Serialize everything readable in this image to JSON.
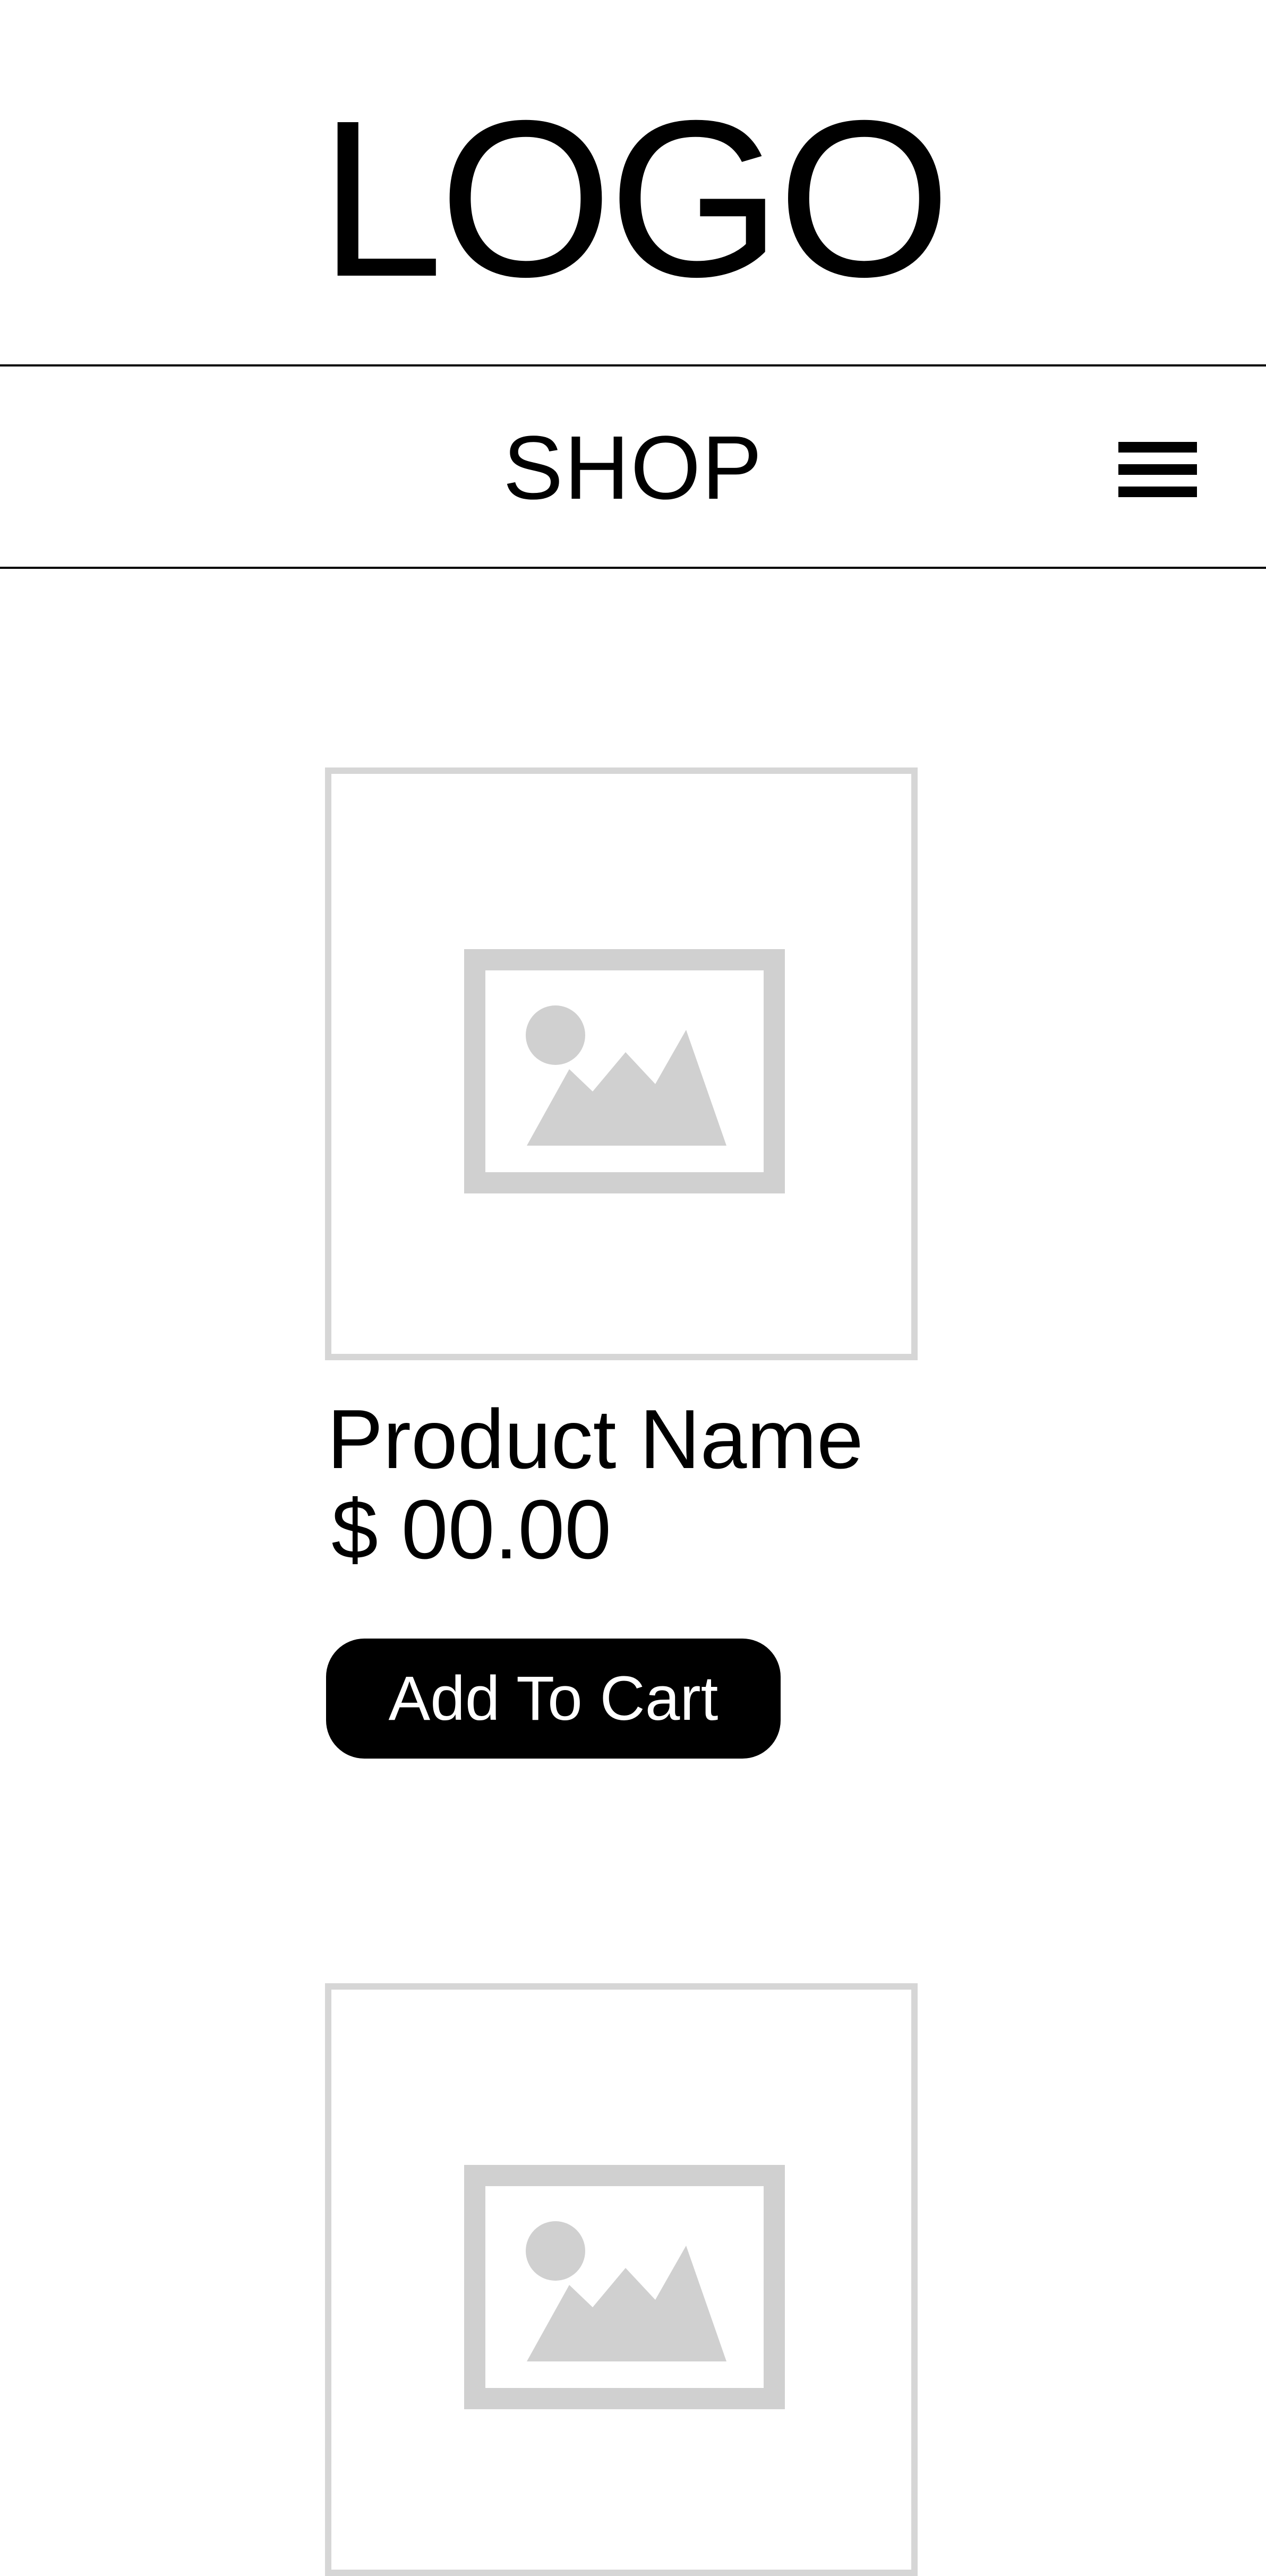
{
  "header": {
    "logo_text": "LOGO"
  },
  "nav": {
    "title": "SHOP",
    "menu_icon": "hamburger-menu-icon"
  },
  "colors": {
    "background": "#ffffff",
    "text": "#000000",
    "placeholder_gray": "#d6d6d6",
    "button_bg": "#000000",
    "button_text": "#ffffff"
  },
  "products": [
    {
      "image_icon": "image-placeholder-icon",
      "name": "Product Name",
      "price": "$ 00.00",
      "button_label": "Add To Cart"
    },
    {
      "image_icon": "image-placeholder-icon"
    }
  ]
}
